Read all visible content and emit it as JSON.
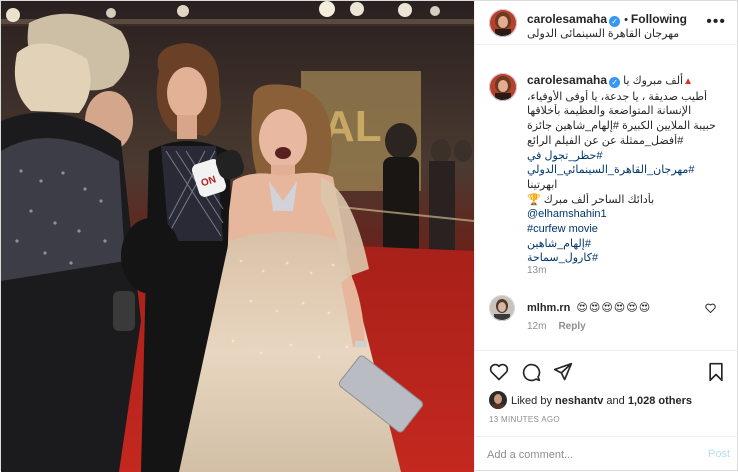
{
  "post": {
    "username": "carolesamaha",
    "follow_status": "Following",
    "location": "مهرجان القاهرة السينمائى الدولى",
    "more_label": "•••"
  },
  "caption": {
    "username": "carolesamaha",
    "first_line": "ألف مبروك يا",
    "lines": [
      "أطيب صديقة ، يا جدعة، يا أوفى الأوفياء،",
      "الإنسانة المتواضعة والعظيمة بأخلاقها",
      "حبيبة الملايين الكبيرة #إلهام_شاهين جائزة",
      "#أفضل_ممثلة عن عن الفيلم الرائع",
      "#حظر_تجول في",
      "#مهرجان_القاهرة_السينمائي_الدولي",
      "ابهرتينا",
      "بأدائك الساحر ألف مبرك 🏆",
      "@elhamshahin1",
      "#curfew movie",
      "#إلهام_شاهين",
      "#كارول_سماحة"
    ],
    "time": "13m"
  },
  "comment": {
    "username": "mlhm.rn",
    "text": "😍😍😍😍😍😍",
    "time": "12m",
    "reply_label": "Reply"
  },
  "likes": {
    "prefix": "Liked by",
    "user": "neshantv",
    "middle": "and",
    "count": "1,028 others"
  },
  "age": "13 MINUTES AGO",
  "add_comment": {
    "placeholder": "Add a comment...",
    "post_label": "Post"
  },
  "colors": {
    "link": "#00376b",
    "verified": "#3897f0",
    "post_disabled": "#b2dffc",
    "carpet": "#b3211c"
  },
  "icons": [
    "verified-badge-icon",
    "more-options-icon",
    "heart-icon",
    "comment-icon",
    "share-icon",
    "save-icon",
    "trophy-icon",
    "warning-triangle-icon"
  ]
}
